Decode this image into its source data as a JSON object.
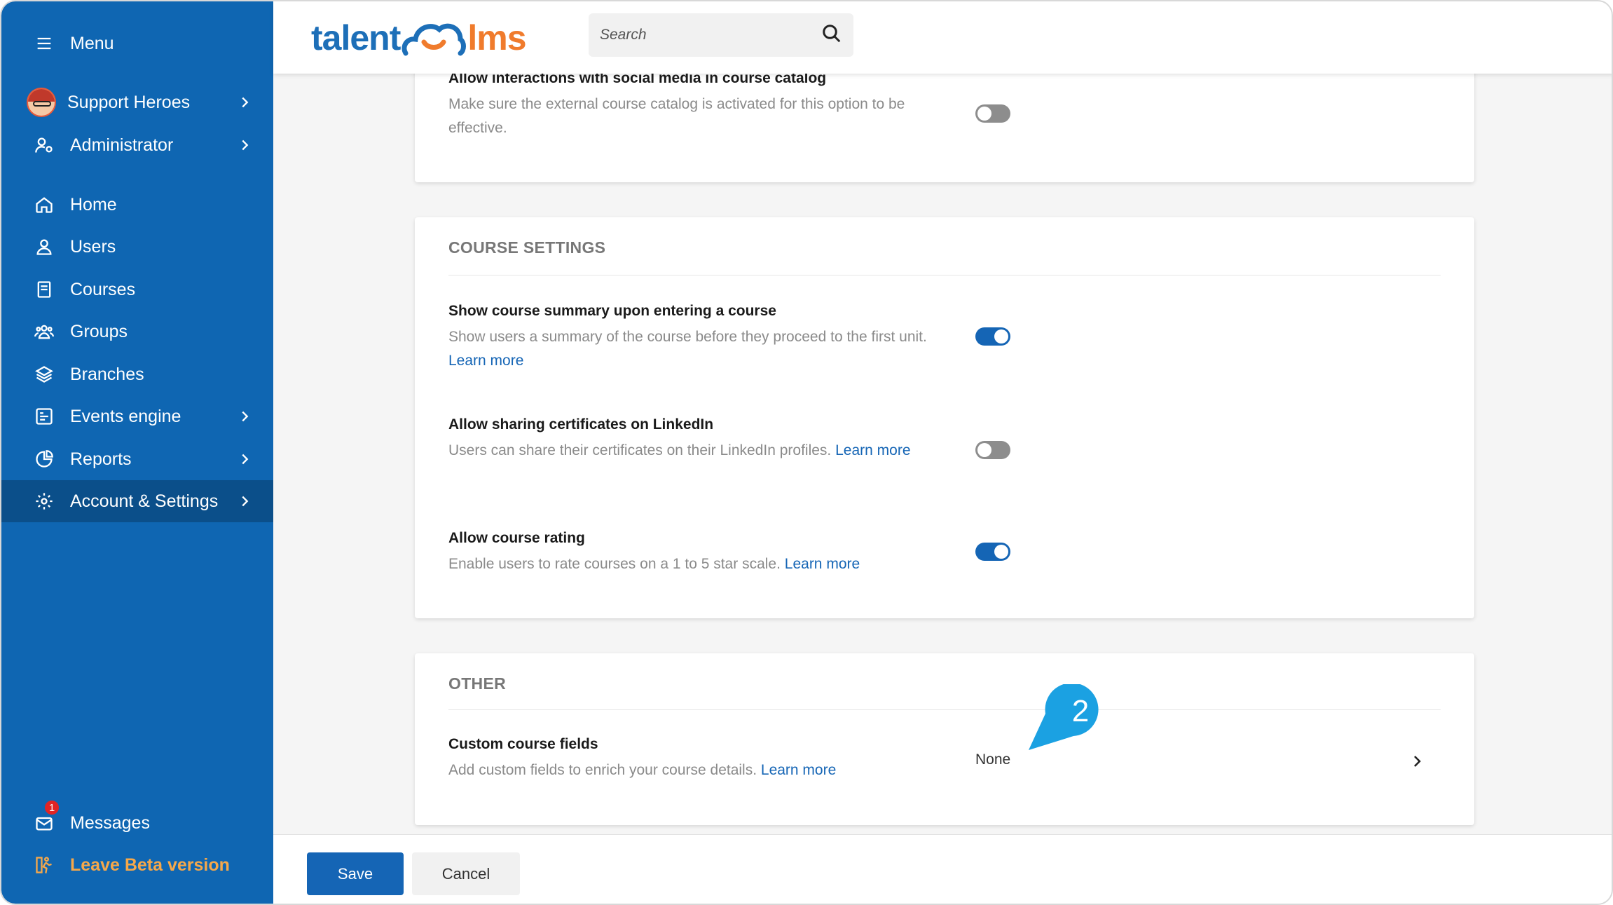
{
  "sidebar": {
    "menu_label": "Menu",
    "portal_label": "Support Heroes",
    "role_label": "Administrator",
    "items": [
      {
        "label": "Home"
      },
      {
        "label": "Users"
      },
      {
        "label": "Courses"
      },
      {
        "label": "Groups"
      },
      {
        "label": "Branches"
      },
      {
        "label": "Events engine"
      },
      {
        "label": "Reports"
      },
      {
        "label": "Account & Settings"
      }
    ],
    "messages_label": "Messages",
    "messages_badge": "1",
    "leave_beta_label": "Leave Beta version"
  },
  "header": {
    "logo_left": "talent",
    "logo_right": "lms",
    "search_placeholder": "Search"
  },
  "top_card": {
    "row_title": "Allow interactions with social media in course catalog",
    "row_desc": "Make sure the external course catalog is activated for this option to be effective.",
    "toggle": "off"
  },
  "course_settings": {
    "title": "COURSE SETTINGS",
    "rows": [
      {
        "title": "Show course summary upon entering a course",
        "desc": "Show users a summary of the course before they proceed to the first unit.",
        "link": "Learn more",
        "toggle": "on"
      },
      {
        "title": "Allow sharing certificates on LinkedIn",
        "desc": "Users can share their certificates on their LinkedIn profiles.",
        "link": "Learn more",
        "toggle": "off"
      },
      {
        "title": "Allow course rating",
        "desc": "Enable users to rate courses on a 1 to 5 star scale.",
        "link": "Learn more",
        "toggle": "on"
      }
    ]
  },
  "other": {
    "title": "OTHER",
    "row_title": "Custom course fields",
    "row_desc": "Add custom fields to enrich your course details.",
    "row_link": "Learn more",
    "row_value": "None"
  },
  "callout_number": "2",
  "footer": {
    "save_label": "Save",
    "cancel_label": "Cancel"
  },
  "colors": {
    "sidebar": "#0f66b2",
    "sidebar_active": "#0b4f8a",
    "accent": "#1565b5",
    "callout": "#1ba1e2",
    "leave_beta": "#f6a84a"
  }
}
